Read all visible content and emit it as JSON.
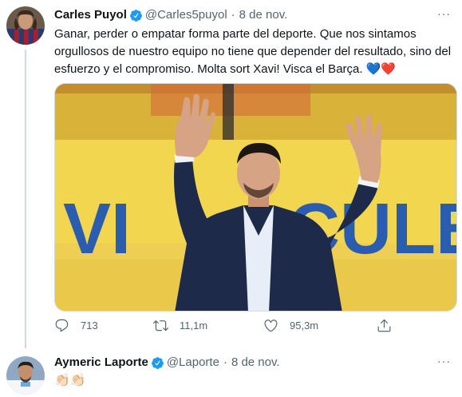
{
  "tweets": [
    {
      "author": {
        "name": "Carles Puyol",
        "handle": "@Carles5puyol",
        "verified": true
      },
      "separator": "·",
      "date": "8 de nov.",
      "more_label": "···",
      "text": "Ganar, perder o empatar forma parte del deporte. Que nos sintamos orgullosos de nuestro equipo no tiene que depender del resultado, sino del esfuerzo y el compromiso. Molta sort Xavi! Visca el Barça. 💙❤️",
      "media": {
        "banner_text": "VI CULE",
        "banner_text_left": "VI",
        "banner_text_right": "CULE"
      },
      "actions": {
        "replies": "713",
        "retweets": "11,1m",
        "likes": "95,3m"
      }
    },
    {
      "author": {
        "name": "Aymeric Laporte",
        "handle": "@Laporte",
        "verified": true
      },
      "separator": "·",
      "date": "8 de nov.",
      "more_label": "···",
      "text": "👏🏻👏🏻"
    }
  ],
  "colors": {
    "verified": "#1d9bf0",
    "secondary_text": "#536471",
    "primary_text": "#0f1419",
    "border": "#cfd9de",
    "banner_blue": "#2a5db0",
    "stadium_yellow": "#f2c21a"
  }
}
